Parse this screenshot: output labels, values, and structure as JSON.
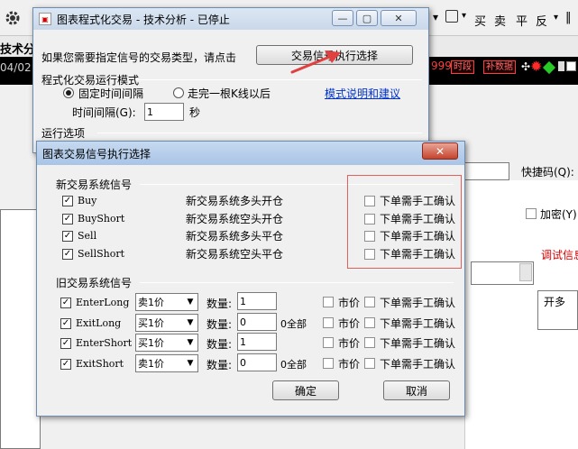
{
  "background": {
    "toolbar": {
      "items": [
        "买",
        "卖",
        "平",
        "反"
      ],
      "left_label": "技术分",
      "date_text": "04/02",
      "number_text": "999",
      "tag_time": "时段",
      "tag_fill": "补数据",
      "shortcut_label": "快捷码(Q):",
      "encrypt_label": "加密(Y)",
      "debug_label": "调试信息",
      "combo_value": "开多"
    }
  },
  "main_window": {
    "title": "图表程式化交易 - 技术分析 - 已停止",
    "prompt": "如果您需要指定信号的交易类型，请点击",
    "select_button": "交易信号执行选择",
    "run_mode_header": "程式化交易运行模式",
    "radio_fixed": "固定时间间隔",
    "radio_kline": "走完一根K线以后",
    "link_mode": "模式说明和建议",
    "interval_label": "时间间隔(G):",
    "interval_value": "1",
    "interval_unit": "秒",
    "options_header": "运行选项"
  },
  "dialog": {
    "title": "图表交易信号执行选择",
    "new_section": "新交易系统信号",
    "new_signals": [
      {
        "name": "Buy",
        "desc": "新交易系统多头开仓",
        "manual": "下单需手工确认"
      },
      {
        "name": "BuyShort",
        "desc": "新交易系统空头开仓",
        "manual": "下单需手工确认"
      },
      {
        "name": "Sell",
        "desc": "新交易系统多头平仓",
        "manual": "下单需手工确认"
      },
      {
        "name": "SellShort",
        "desc": "新交易系统空头平仓",
        "manual": "下单需手工确认"
      }
    ],
    "old_section": "旧交易系统信号",
    "qty_label": "数量:",
    "market_label": "市价",
    "manual_label": "下单需手工确认",
    "old_signals": [
      {
        "name": "EnterLong",
        "price": "卖1价",
        "qty": "1",
        "all": ""
      },
      {
        "name": "ExitLong",
        "price": "买1价",
        "qty": "0",
        "all": "0全部"
      },
      {
        "name": "EnterShort",
        "price": "买1价",
        "qty": "1",
        "all": ""
      },
      {
        "name": "ExitShort",
        "price": "卖1价",
        "qty": "0",
        "all": "0全部"
      }
    ],
    "ok_button": "确定",
    "cancel_button": "取消"
  },
  "colors": {
    "annotation": "#e05050",
    "link": "#0033cc",
    "tag": "#ff3b3b"
  }
}
